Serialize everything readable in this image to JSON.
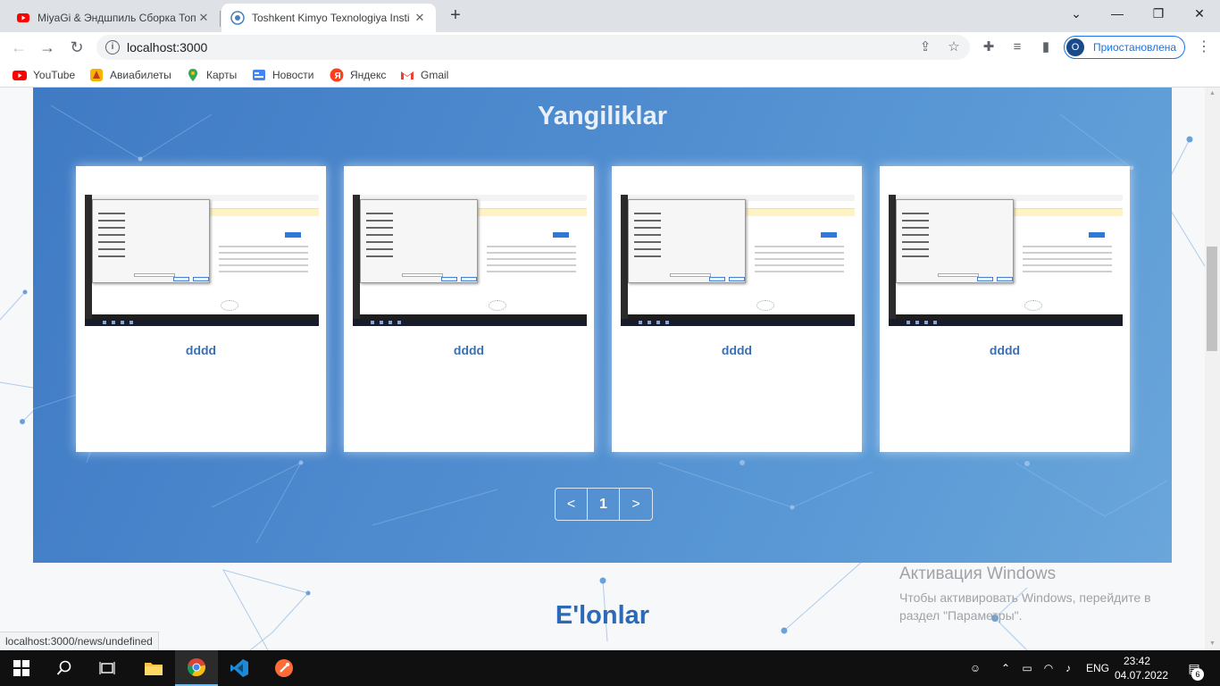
{
  "browser": {
    "tabs": [
      {
        "title": "MiyaGi & Эндшпиль Сборка Топ",
        "active": false
      },
      {
        "title": "Toshkent Kimyo Texnologiya Insti",
        "active": true
      }
    ],
    "address": "localhost:3000",
    "profile_status": "Приостановлена",
    "profile_initial": "O",
    "bookmarks": [
      "YouTube",
      "Авиабилеты",
      "Карты",
      "Новости",
      "Яндекс",
      "Gmail"
    ],
    "status_url": "localhost:3000/news/undefined"
  },
  "page": {
    "news_title": "Yangiliklar",
    "news_cards": [
      {
        "caption": "dddd"
      },
      {
        "caption": "dddd"
      },
      {
        "caption": "dddd"
      },
      {
        "caption": "dddd"
      }
    ],
    "pagination": {
      "prev": "<",
      "current": "1",
      "next": ">"
    },
    "announcements_title": "E'lonlar"
  },
  "windows_activation": {
    "heading": "Активация Windows",
    "body": "Чтобы активировать Windows, перейдите в раздел \"Параметры\"."
  },
  "taskbar": {
    "language": "ENG",
    "time": "23:42",
    "date": "04.07.2022",
    "notification_count": "6"
  },
  "colors": {
    "news_bg": "#4a86cc",
    "accent_text": "#2a6ab7",
    "card_caption": "#3a6fb3"
  }
}
